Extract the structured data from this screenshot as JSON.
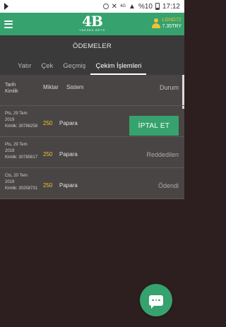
{
  "status_bar": {
    "battery": "%10",
    "time": "17:12",
    "network": "4G"
  },
  "header": {
    "logo_mark": "4B",
    "logo_sub": "YÜKSEK BETS",
    "username": "LGND72",
    "balance": "7.35TRY"
  },
  "page": {
    "title": "ÖDEMELER"
  },
  "tabs": [
    {
      "label": "Yatır"
    },
    {
      "label": "Çek"
    },
    {
      "label": "Geçmiş"
    },
    {
      "label": "Çekim İşlemleri"
    }
  ],
  "table": {
    "headers": {
      "date": "Tarih",
      "id": "Kimlik",
      "amount": "Miktar",
      "system": "Sistem",
      "status": "Durum"
    },
    "rows": [
      {
        "day": "Pts, 29 Tem",
        "year": "2019",
        "id_label": "Kimlik:",
        "id": "30786258",
        "amount": "250",
        "system": "Papara",
        "action": "İPTAL ET"
      },
      {
        "day": "Pts, 29 Tem",
        "year": "2019",
        "id_label": "Kimlik:",
        "id": "30785817",
        "amount": "250",
        "system": "Papara",
        "status": "Reddedilen"
      },
      {
        "day": "Cts, 20 Tem",
        "year": "2019",
        "id_label": "Kimlik:",
        "id": "30258731",
        "amount": "250",
        "system": "Papara",
        "status": "Ödendi"
      }
    ]
  },
  "colors": {
    "brand_green": "#36a26d",
    "amount_yellow": "#f1c232",
    "background": "#2d1f1f"
  }
}
